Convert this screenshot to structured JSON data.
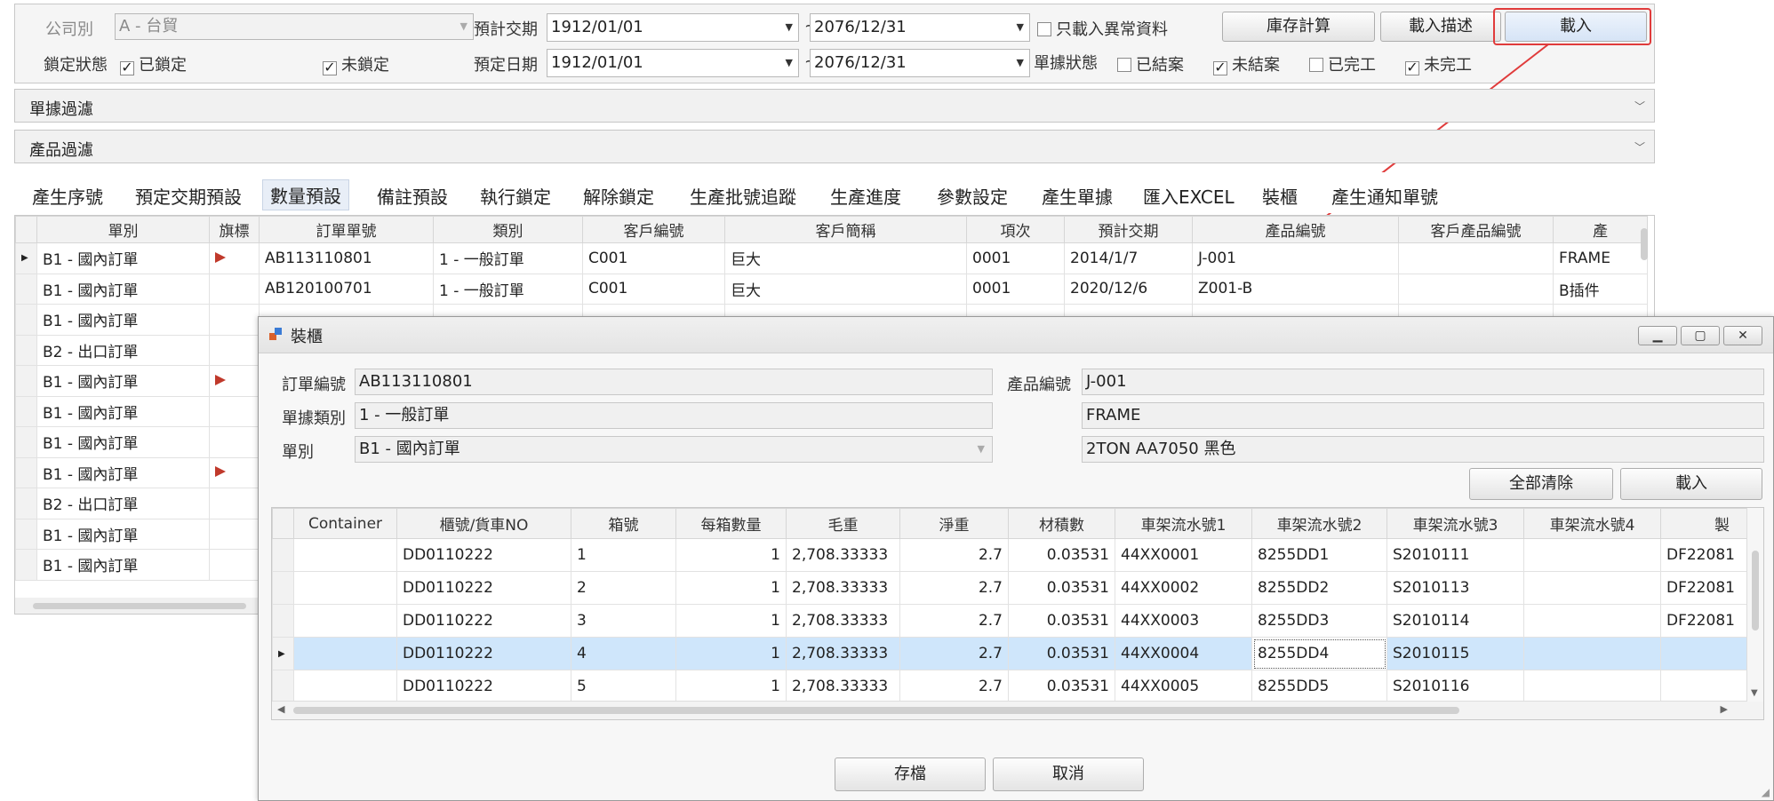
{
  "filters": {
    "company_label": "公司別",
    "company_value": "A - 台貿",
    "expected_delivery_label": "預計交期",
    "expected_delivery_from": "1912/01/01",
    "expected_delivery_to": "2076/12/31",
    "tilde": "~",
    "only_abnormal_label": "只載入異常資料",
    "stock_calc_button": "庫存計算",
    "load_desc_button": "載入描述",
    "load_button": "載入",
    "lock_status_label": "鎖定狀態",
    "locked_label": "已鎖定",
    "unlocked_label": "未鎖定",
    "scheduled_date_label": "預定日期",
    "scheduled_from": "1912/01/01",
    "scheduled_to": "2076/12/31",
    "doc_status_label": "單據狀態",
    "closed_label": "已結案",
    "not_closed_label": "未結案",
    "completed_label": "已完工",
    "not_completed_label": "未完工"
  },
  "sections": {
    "doc_filter": "單據過濾",
    "product_filter": "產品過濾"
  },
  "toolbar": {
    "items": [
      "產生序號",
      "預定交期預設",
      "數量預設",
      "備註預設",
      "執行鎖定",
      "解除鎖定",
      "生產批號追蹤",
      "生產進度",
      "參數設定",
      "產生單據",
      "匯入EXCEL",
      "裝櫃",
      "產生通知單號"
    ]
  },
  "main_grid": {
    "headers": [
      "單別",
      "旗標",
      "訂單單號",
      "類別",
      "客戶編號",
      "客戶簡稱",
      "項次",
      "預計交期",
      "產品編號",
      "客戶產品編號",
      "產"
    ],
    "rows": [
      {
        "type": "B1 - 國內訂單",
        "flag": true,
        "order": "AB113110801",
        "cat": "1 - 一般訂單",
        "cust": "C001",
        "name": "巨大",
        "item": "0001",
        "date": "2014/1/7",
        "prod": "J-001",
        "cprod": "",
        "p": "FRAME"
      },
      {
        "type": "B1 - 國內訂單",
        "flag": false,
        "order": "AB120100701",
        "cat": "1 - 一般訂單",
        "cust": "C001",
        "name": "巨大",
        "item": "0001",
        "date": "2020/12/6",
        "prod": "Z001-B",
        "cprod": "",
        "p": "B插件"
      },
      {
        "type": "B1 - 國內訂單",
        "flag": false
      },
      {
        "type": "B2 - 出口訂單",
        "flag": false
      },
      {
        "type": "B1 - 國內訂單",
        "flag": true
      },
      {
        "type": "B1 - 國內訂單",
        "flag": false
      },
      {
        "type": "B1 - 國內訂單",
        "flag": false
      },
      {
        "type": "B1 - 國內訂單",
        "flag": true
      },
      {
        "type": "B2 - 出口訂單",
        "flag": false
      },
      {
        "type": "B1 - 國內訂單",
        "flag": false
      },
      {
        "type": "B1 - 國內訂單",
        "flag": false
      }
    ]
  },
  "dialog": {
    "title": "裝櫃",
    "order_no_label": "訂單編號",
    "order_no": "AB113110801",
    "doc_type_label": "單據類別",
    "doc_type": "1 - 一般訂單",
    "order_kind_label": "單別",
    "order_kind": "B1 - 國內訂單",
    "product_no_label": "產品編號",
    "product_no": "J-001",
    "product_name": "FRAME",
    "product_spec": "2TON AA7050 黑色",
    "clear_all_button": "全部清除",
    "load_button": "載入",
    "save_button": "存檔",
    "cancel_button": "取消",
    "grid_headers": [
      "Container",
      "櫃號/貨車NO",
      "箱號",
      "每箱數量",
      "毛重",
      "淨重",
      "材積數",
      "車架流水號1",
      "車架流水號2",
      "車架流水號3",
      "車架流水號4",
      "製"
    ],
    "rows": [
      {
        "container": "",
        "no": "DD0110222",
        "box": "1",
        "qty": "1",
        "gross": "2,708.33333",
        "net": "2.7",
        "vol": "0.03531",
        "s1": "44XX0001",
        "s2": "8255DD1",
        "s3": "S2010111",
        "s4": "",
        "m": "DF22081"
      },
      {
        "container": "",
        "no": "DD0110222",
        "box": "2",
        "qty": "1",
        "gross": "2,708.33333",
        "net": "2.7",
        "vol": "0.03531",
        "s1": "44XX0002",
        "s2": "8255DD2",
        "s3": "S2010113",
        "s4": "",
        "m": "DF22081"
      },
      {
        "container": "",
        "no": "DD0110222",
        "box": "3",
        "qty": "1",
        "gross": "2,708.33333",
        "net": "2.7",
        "vol": "0.03531",
        "s1": "44XX0003",
        "s2": "8255DD3",
        "s3": "S2010114",
        "s4": "",
        "m": "DF22081"
      },
      {
        "container": "",
        "no": "DD0110222",
        "box": "4",
        "qty": "1",
        "gross": "2,708.33333",
        "net": "2.7",
        "vol": "0.03531",
        "s1": "44XX0004",
        "s2": "8255DD4",
        "s3": "S2010115",
        "s4": "",
        "m": ""
      },
      {
        "container": "",
        "no": "DD0110222",
        "box": "5",
        "qty": "1",
        "gross": "2,708.33333",
        "net": "2.7",
        "vol": "0.03531",
        "s1": "44XX0005",
        "s2": "8255DD5",
        "s3": "S2010116",
        "s4": "",
        "m": ""
      }
    ]
  },
  "colors": {
    "highlight": "#e03b3b",
    "selected_row": "#cfe6fb"
  }
}
